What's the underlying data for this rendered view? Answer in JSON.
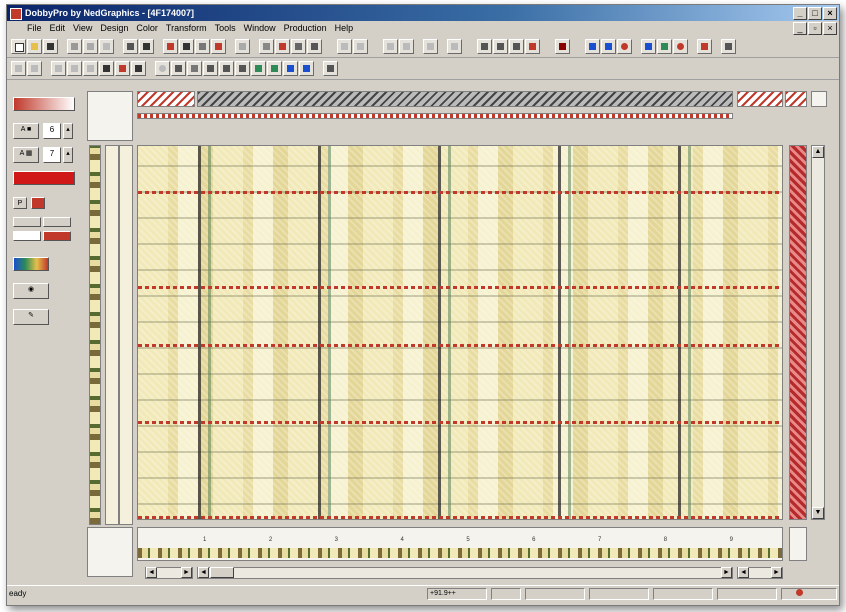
{
  "window": {
    "title": "DobbyPro by NedGraphics  - [4F174007]"
  },
  "menu": [
    "File",
    "Edit",
    "View",
    "Design",
    "Color",
    "Transform",
    "Tools",
    "Window",
    "Production",
    "Help"
  ],
  "left_panel": {
    "field_top_value": "6",
    "field_bottom_value": "7"
  },
  "ruler_marks": [
    "1",
    "2",
    "3",
    "4",
    "5",
    "6",
    "7",
    "8",
    "9"
  ],
  "status": {
    "left_text": "eady",
    "coords": "+91.9++"
  },
  "colors": {
    "title_start": "#0a246a",
    "accent_red": "#c0392b",
    "fabric_base": "#f2e9b8"
  }
}
